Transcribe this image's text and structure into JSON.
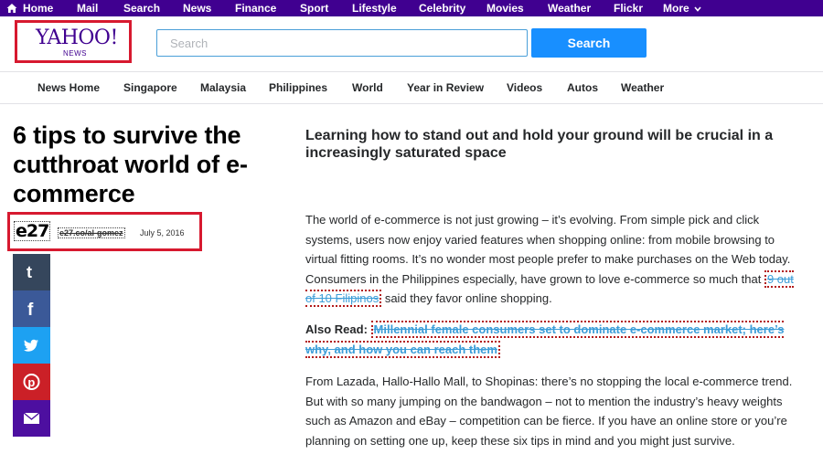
{
  "topnav": {
    "items": [
      {
        "label": "Home"
      },
      {
        "label": "Mail"
      },
      {
        "label": "Search"
      },
      {
        "label": "News"
      },
      {
        "label": "Finance"
      },
      {
        "label": "Sport"
      },
      {
        "label": "Lifestyle"
      },
      {
        "label": "Celebrity"
      },
      {
        "label": "Movies"
      },
      {
        "label": "Weather"
      },
      {
        "label": "Flickr"
      },
      {
        "label": "More"
      }
    ],
    "background": "#400090"
  },
  "header": {
    "logo_text": "YAHOO!",
    "logo_sub": "NEWS",
    "search_placeholder": "Search",
    "search_value": "",
    "search_button": "Search"
  },
  "section_nav": {
    "items": [
      {
        "label": "News Home"
      },
      {
        "label": "Singapore"
      },
      {
        "label": "Malaysia"
      },
      {
        "label": "Philippines"
      },
      {
        "label": "World"
      },
      {
        "label": "Year in Review"
      },
      {
        "label": "Videos"
      },
      {
        "label": "Autos"
      },
      {
        "label": "Weather"
      }
    ]
  },
  "article": {
    "headline": "6 tips to survive the cutthroat world of e-commerce",
    "source_logo": "e27",
    "author": "e27.co/al-gomez",
    "date": "July 5, 2016",
    "subhead": "Learning how to stand out and hold your ground will be crucial in a increasingly saturated space",
    "para1_text": "The world of e-commerce is not just growing – it’s evolving. From simple pick and click systems, users now enjoy varied features when shopping online: from mobile browsing to virtual fitting rooms. It’s no wonder most people prefer to make purchases on the Web today. Consumers in the Philippines especially, have grown to love e-commerce so much that ",
    "para1_link": "9 out of 10 Filipinos",
    "para1_after": " said they favor online shopping.",
    "also_read_label": "Also Read:",
    "also_read_link": "Millennial female consumers set to dominate e-commerce market; here’s why, and how you can reach them",
    "para2": "From Lazada, Hallo-Hallo Mall, to Shopinas: there’s no stopping the local e-commerce trend. But with so many jumping on the bandwagon – not to mention the industry’s heavy weights such as Amazon and eBay – competition can be fierce. If you have an online store or you’re planning on setting one up, keep these six tips in mind and you might just survive."
  },
  "share": [
    {
      "icon": "tumblr-icon",
      "color": "#35465c"
    },
    {
      "icon": "facebook-icon",
      "color": "#3b5998"
    },
    {
      "icon": "twitter-icon",
      "color": "#1da1f2"
    },
    {
      "icon": "pinterest-icon",
      "color": "#cb2027"
    },
    {
      "icon": "mail-icon",
      "color": "#4d0fa0"
    }
  ],
  "colors": {
    "accent_purple": "#400090",
    "search_blue": "#188fff",
    "link_blue": "#3c9dd8",
    "highlight_red": "#d7192f"
  }
}
